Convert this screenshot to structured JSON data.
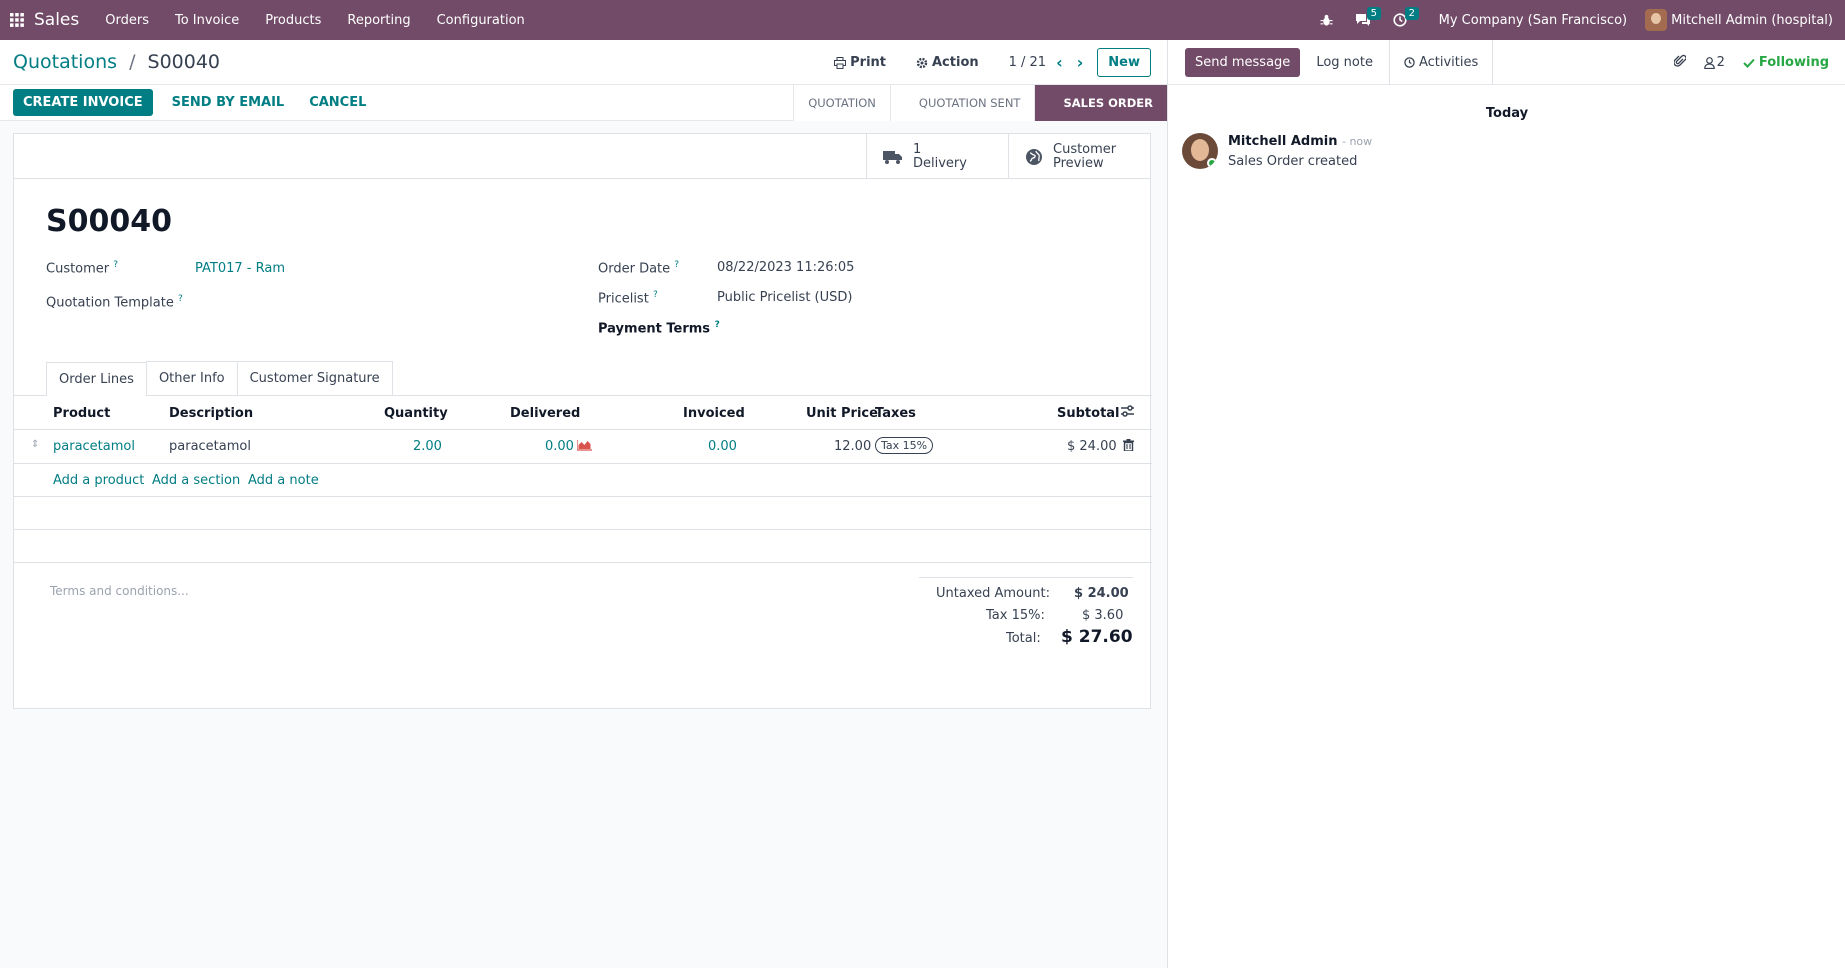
{
  "navbar": {
    "app": "Sales",
    "menus": [
      "Orders",
      "To Invoice",
      "Products",
      "Reporting",
      "Configuration"
    ],
    "messages_badge": "5",
    "activities_badge": "2",
    "company": "My Company (San Francisco)",
    "user": "Mitchell Admin (hospital)"
  },
  "breadcrumb": {
    "parent": "Quotations",
    "current": "S00040"
  },
  "control": {
    "print": "Print",
    "action": "Action",
    "pager": "1 / 21",
    "new": "New"
  },
  "actions": {
    "create_invoice": "Create Invoice",
    "send_email": "Send by Email",
    "cancel": "Cancel"
  },
  "statusbar": [
    "Quotation",
    "Quotation Sent",
    "Sales Order"
  ],
  "smart_buttons": {
    "delivery_count": "1",
    "delivery_label": "Delivery",
    "preview_line1": "Customer",
    "preview_line2": "Preview"
  },
  "form": {
    "reference": "S00040",
    "customer_label": "Customer",
    "customer_value": "PAT017 - Ram",
    "template_label": "Quotation Template",
    "order_date_label": "Order Date",
    "order_date_value": "08/22/2023 11:26:05",
    "pricelist_label": "Pricelist",
    "pricelist_value": "Public Pricelist (USD)",
    "payment_terms_label": "Payment Terms",
    "help_mark": "?"
  },
  "tabs": [
    "Order Lines",
    "Other Info",
    "Customer Signature"
  ],
  "table": {
    "headers": {
      "product": "Product",
      "description": "Description",
      "quantity": "Quantity",
      "delivered": "Delivered",
      "invoiced": "Invoiced",
      "unit_price": "Unit Price",
      "taxes": "Taxes",
      "subtotal": "Subtotal"
    },
    "row": {
      "product": "paracetamol",
      "description": "paracetamol",
      "quantity": "2.00",
      "delivered": "0.00",
      "invoiced": "0.00",
      "unit_price": "12.00",
      "taxes": "Tax 15%",
      "subtotal": "$ 24.00"
    },
    "add_product": "Add a product",
    "add_section": "Add a section",
    "add_note": "Add a note"
  },
  "terms_placeholder": "Terms and conditions...",
  "totals": {
    "untaxed_label": "Untaxed Amount:",
    "untaxed_value": "$ 24.00",
    "tax_label": "Tax 15%:",
    "tax_value": "$ 3.60",
    "total_label": "Total:",
    "total_value": "$ 27.60"
  },
  "chatter": {
    "send_message": "Send message",
    "log_note": "Log note",
    "activities": "Activities",
    "followers_count": "2",
    "following": "Following",
    "today": "Today",
    "author": "Mitchell Admin",
    "time": "- now",
    "body": "Sales Order created"
  },
  "colors": {
    "brand": "#714b67",
    "accent": "#017e84",
    "success": "#28a745"
  }
}
